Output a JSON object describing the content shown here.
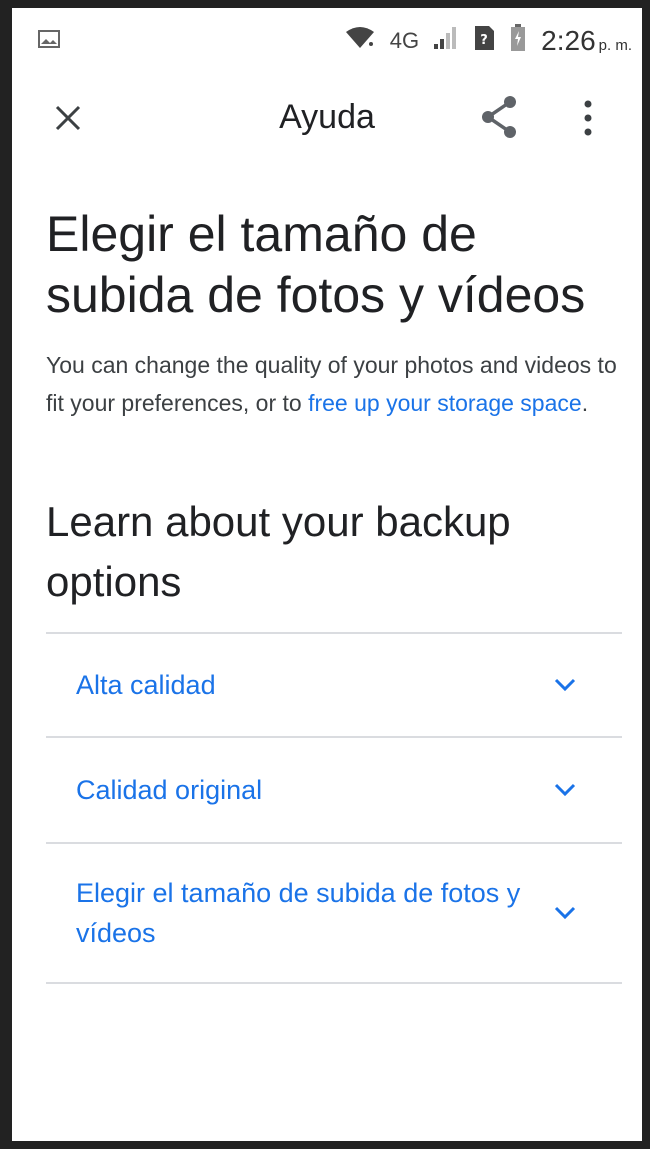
{
  "status_bar": {
    "network": "4G",
    "time": "2:26",
    "ampm": "p. m."
  },
  "app_bar": {
    "title": "Ayuda"
  },
  "article": {
    "title": "Elegir el tamaño de subida de fotos y vídeos",
    "intro_text": "You can change the quality of your photos and videos to fit your preferences, or to ",
    "intro_link": "free up your storage space",
    "intro_end": ".",
    "section_heading": "Learn about your backup options",
    "options": [
      {
        "label": "Alta calidad"
      },
      {
        "label": "Calidad original"
      },
      {
        "label": "Elegir el tamaño de subida de fotos y vídeos"
      }
    ]
  },
  "colors": {
    "link": "#1a73e8",
    "text": "#202124",
    "divider": "#dadce0"
  },
  "icons": [
    "image-icon",
    "wifi-icon",
    "signal-icon",
    "sim-icon",
    "battery-icon",
    "close-icon",
    "share-icon",
    "more-vert-icon",
    "chevron-down-icon"
  ]
}
